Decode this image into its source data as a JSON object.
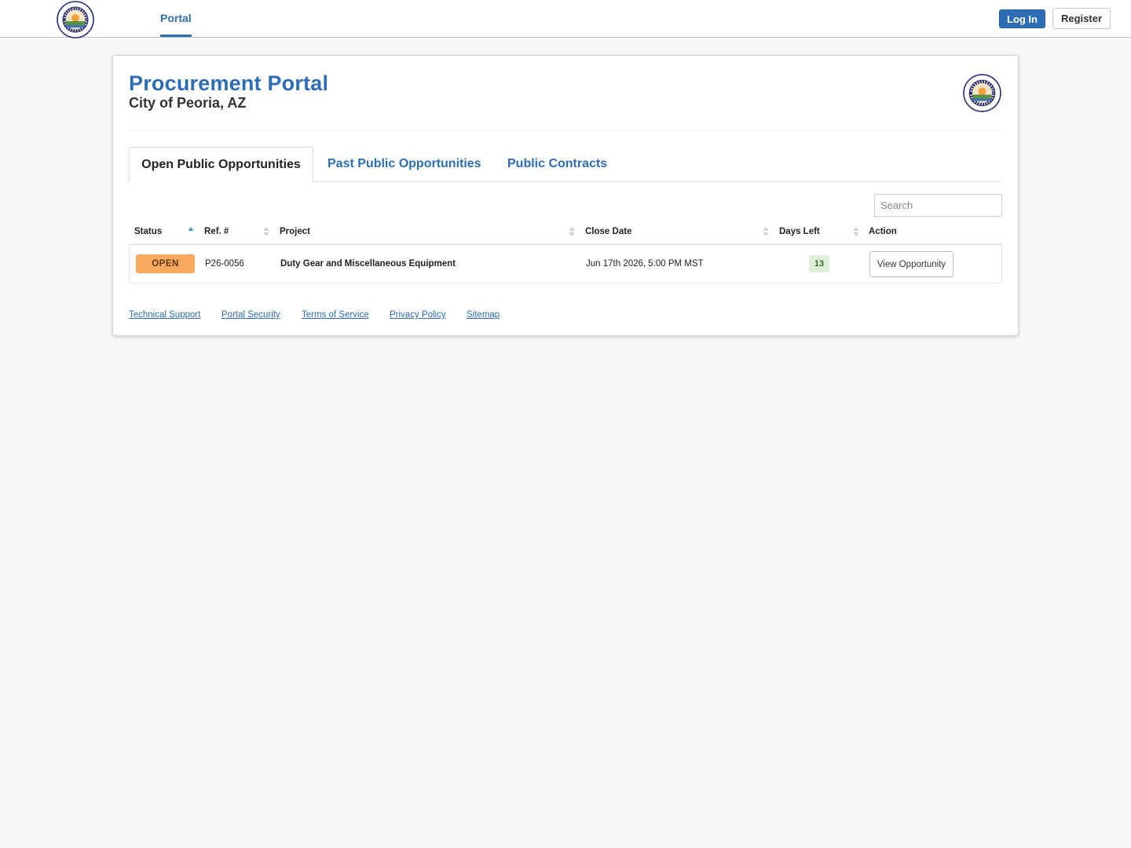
{
  "nav": {
    "portal_label": "Portal",
    "login_label": "Log In",
    "register_label": "Register",
    "logo_icon": "city-of-peoria-seal",
    "accent_color": "#2d6db5"
  },
  "header": {
    "title": "Procurement Portal",
    "subtitle": "City of Peoria, AZ",
    "logo_icon": "city-of-peoria-seal"
  },
  "tabs": [
    {
      "label": "Open Public Opportunities",
      "active": true
    },
    {
      "label": "Past Public Opportunities",
      "active": false
    },
    {
      "label": "Public Contracts",
      "active": false
    }
  ],
  "search": {
    "placeholder": "Search",
    "value": ""
  },
  "table": {
    "columns": [
      {
        "label": "Status",
        "sort": "ascending"
      },
      {
        "label": "Ref. #",
        "sort": "none"
      },
      {
        "label": "Project",
        "sort": "none"
      },
      {
        "label": "Close Date",
        "sort": "none"
      },
      {
        "label": "Days Left",
        "sort": "none"
      },
      {
        "label": "Action",
        "sort": "none"
      }
    ],
    "rows": [
      {
        "status": "OPEN",
        "status_color": "#f8aa60",
        "ref": "P26-0056",
        "project": "Duty Gear and Miscellaneous Equipment",
        "close_date": "Jun 17th 2026, 5:00 PM MST",
        "days_left": "13",
        "action_label": "View Opportunity"
      }
    ]
  },
  "footer": {
    "links": [
      "Technical Support",
      "Portal Security",
      "Terms of Service",
      "Privacy Policy",
      "Sitemap"
    ]
  }
}
